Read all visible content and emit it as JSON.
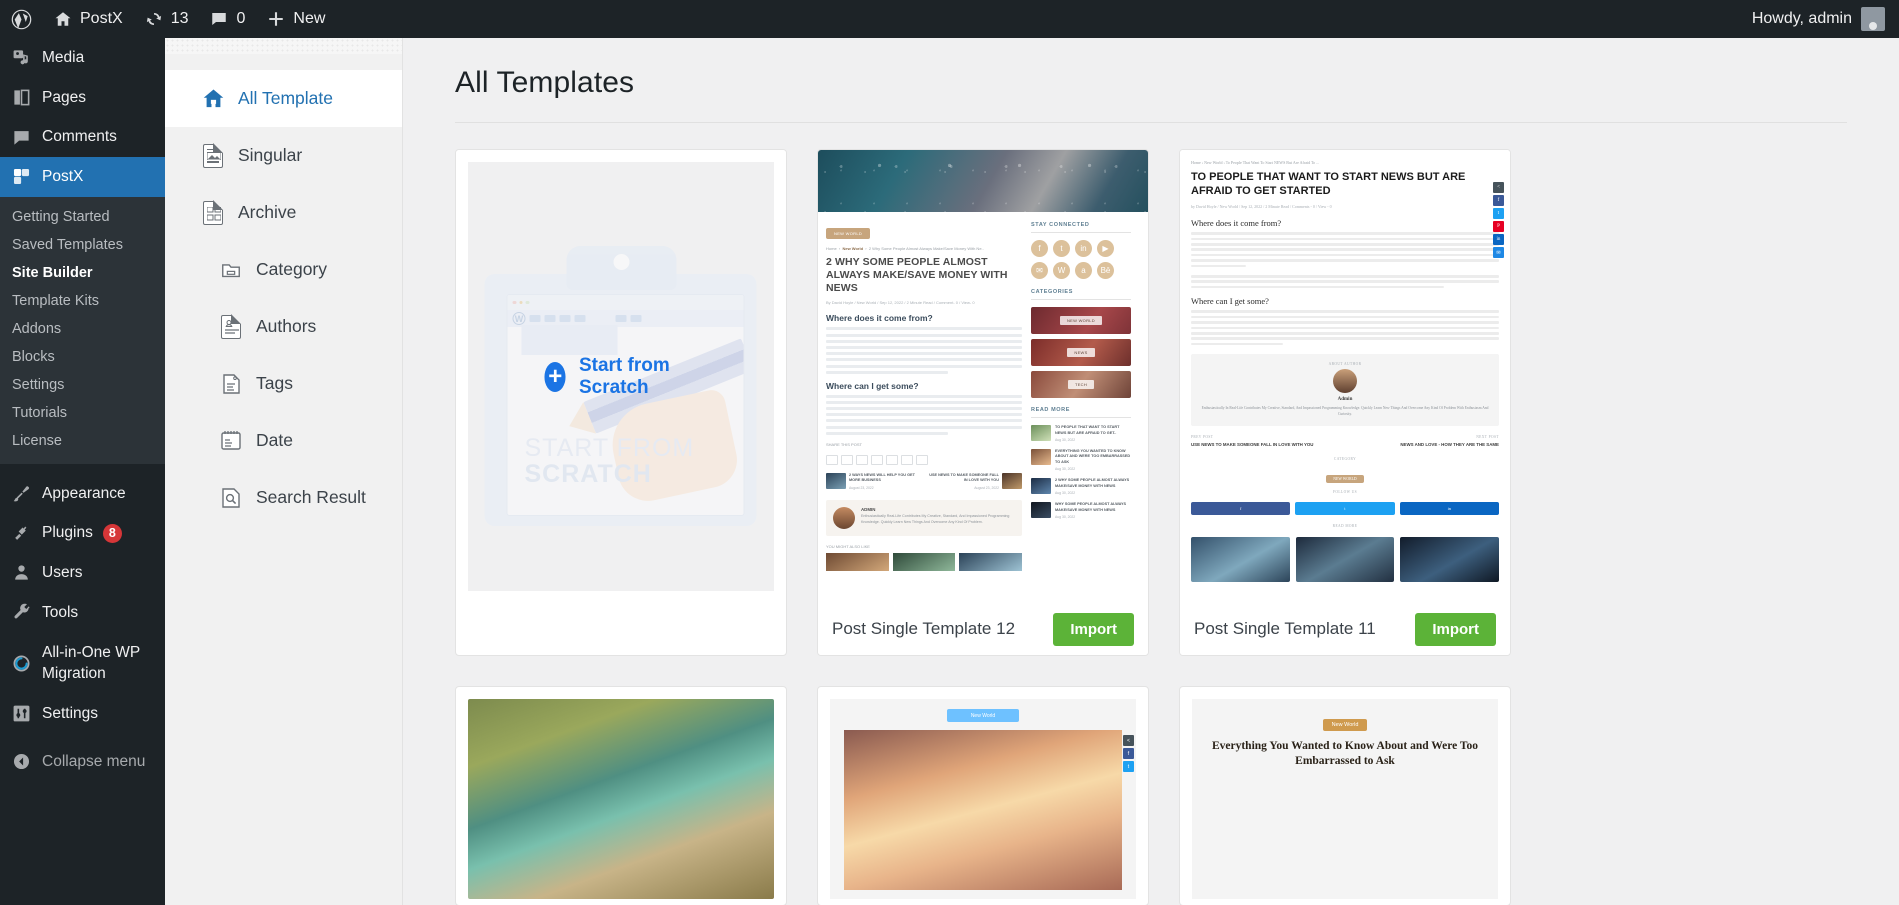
{
  "adminbar": {
    "wp_logo_icon": "wordpress-logo-icon",
    "site_name": "PostX",
    "site_icon": "home-icon",
    "updates_icon": "updates-icon",
    "updates_count": "13",
    "comments_icon": "comment-bubble-icon",
    "comments_count": "0",
    "new_icon": "plus-icon",
    "new_label": "New",
    "howdy": "Howdy, admin",
    "avatar_icon": "user-avatar-icon"
  },
  "wpmenu": {
    "items": [
      {
        "label": "Media",
        "icon": "media-icon",
        "current": false
      },
      {
        "label": "Pages",
        "icon": "pages-icon",
        "current": false
      },
      {
        "label": "Comments",
        "icon": "comments-icon",
        "current": false
      },
      {
        "label": "PostX",
        "icon": "postx-icon",
        "current": true
      }
    ],
    "submenu": [
      {
        "label": "Getting Started",
        "active": false
      },
      {
        "label": "Saved Templates",
        "active": false
      },
      {
        "label": "Site Builder",
        "active": true
      },
      {
        "label": "Template Kits",
        "active": false
      },
      {
        "label": "Addons",
        "active": false
      },
      {
        "label": "Blocks",
        "active": false
      },
      {
        "label": "Settings",
        "active": false
      },
      {
        "label": "Tutorials",
        "active": false
      },
      {
        "label": "License",
        "active": false
      }
    ],
    "items_bottom": [
      {
        "label": "Appearance",
        "icon": "paintbrush-icon",
        "badge": ""
      },
      {
        "label": "Plugins",
        "icon": "plug-icon",
        "badge": "8"
      },
      {
        "label": "Users",
        "icon": "user-icon",
        "badge": ""
      },
      {
        "label": "Tools",
        "icon": "wrench-icon",
        "badge": ""
      },
      {
        "label": "All-in-One WP Migration",
        "icon": "migration-icon",
        "badge": ""
      },
      {
        "label": "Settings",
        "icon": "settings-sliders-icon",
        "badge": ""
      }
    ],
    "collapse_label": "Collapse menu",
    "collapse_icon": "collapse-arrow-icon",
    "accent_color": "#2271b1"
  },
  "typepanel": {
    "items": [
      {
        "label": "All Template",
        "icon": "home-icon",
        "active": true,
        "indent": false
      },
      {
        "label": "Singular",
        "icon": "singular-doc-icon",
        "active": false,
        "indent": false
      },
      {
        "label": "Archive",
        "icon": "archive-doc-icon",
        "active": false,
        "indent": false
      },
      {
        "label": "Category",
        "icon": "folder-icon",
        "active": false,
        "indent": true
      },
      {
        "label": "Authors",
        "icon": "author-doc-icon",
        "active": false,
        "indent": true
      },
      {
        "label": "Tags",
        "icon": "tag-icon",
        "active": false,
        "indent": true
      },
      {
        "label": "Date",
        "icon": "calendar-icon",
        "active": false,
        "indent": true
      },
      {
        "label": "Search Result",
        "icon": "search-doc-icon",
        "active": false,
        "indent": true
      }
    ]
  },
  "main": {
    "page_title": "All Templates",
    "scratch": {
      "label": "Start from Scratch",
      "plus_icon": "plus-circle-icon",
      "art_word_1": "START FROM",
      "art_word_2": "SCRATCH",
      "accent_color": "#1b74e4"
    },
    "import_label": "Import",
    "import_color": "#5cb338",
    "cards": [
      {
        "name": "Post Single Template 12"
      },
      {
        "name": "Post Single Template 11"
      }
    ]
  },
  "preview12": {
    "chip": "NEW WORLD",
    "crumb_home": "Home",
    "crumb_cat": "New World",
    "crumb_post": "2 Why Some People Almost Always Make/Save Money With Ne..",
    "headline": "2 WHY SOME PEOPLE ALMOST ALWAYS MAKE/SAVE MONEY WITH NEWS",
    "meta": "By David Hoyle  /  New World  /  Sep 12, 2022  /  2 Minute Read  /  Comment- 0  /  View- 0",
    "sub1": "Where does it come from?",
    "sub2": "Where can I get some?",
    "share_heading": "SHARE THIS POST",
    "you_might": "YOU MIGHT ALSO LIKE",
    "sidebar_stay": "STAY CONNECTED",
    "sidebar_categories": "CATEGORIES",
    "sidebar_readmore": "READ MORE",
    "cat_labels": [
      "NEW WORLD",
      "NEWS",
      "TECH"
    ],
    "read_more": [
      {
        "title": "TO PEOPLE THAT WANT TO START NEWS BUT ARE AFRAID TO GET..",
        "date": "Aug 30, 2022"
      },
      {
        "title": "EVERYTHING YOU WANTED TO KNOW ABOUT AND WERE TOO EMBARRASSED TO ASK",
        "date": "Aug 30, 2022"
      },
      {
        "title": "2 WHY SOME PEOPLE ALMOST ALWAYS MAKE/SAVE MONEY WITH NEWS",
        "date": "Aug 30, 2022"
      },
      {
        "title": "WHY SOME PEOPLE ALMOST ALWAYS MAKE/SAVE MONEY WITH NEWS",
        "date": "Aug 30, 2022"
      }
    ],
    "post_items": [
      {
        "title": "2 WAYS NEWS WILL HELP YOU GET MORE BUSINESS",
        "date": "August 23, 2022"
      },
      {
        "title": "USE NEWS TO MAKE SOMEONE FALL IN LOVE WITH YOU",
        "date": "August 23, 2022"
      }
    ],
    "author_name": "ADMIN",
    "author_bio": "Enthusiastically Real-Life Contributes My Creative, Standard, And Impassioned Programming Knowledge. Quickly Learn New Things And Overcome Any Kind Of Problem."
  },
  "preview11": {
    "crumb": "Home  ›  New World  ›  To People That Want To Start NEWS But Are Afraid To ...",
    "headline": "TO PEOPLE THAT WANT TO START NEWS BUT ARE AFRAID TO GET STARTED",
    "meta": "by David Hoyle  /  New World  /  Sep 12, 2022  /  2 Minute Read  /  Comments - 0  /  View - 0",
    "sub1": "Where does it come from?",
    "sub2": "Where can I get some?",
    "about_author": "ABOUT AUTHOR",
    "author_name": "Admin",
    "author_bio": "Enthusiastically In Real-Life Contributes My Creative, Standard, And Impassioned Programming Knowledge. Quickly Learn New Things And Overcome Any Kind Of Problem With Enthusiasm And Curiosity.",
    "prev_label": "PREV POST",
    "next_label": "NEXT POST",
    "prev_title": "USE NEWS TO MAKE SOMEONE FALL IN LOVE WITH YOU",
    "next_title": "NEWS AND LOVE - HOW THEY ARE THE SAME",
    "category_heading": "CATEGORY",
    "category_chip": "NEW WORLD",
    "follow_heading": "FOLLOW US",
    "read_more": "READ MORE",
    "share_rail_icons": [
      "share-icon",
      "facebook-icon",
      "twitter-icon",
      "pinterest-icon",
      "linkedin-icon",
      "email-icon"
    ]
  },
  "bottom_row": {
    "card2_chip": "New World",
    "card3_chip": "New World",
    "card3_headline": "Everything You Wanted to Know About and Were Too Embarrassed to Ask"
  }
}
